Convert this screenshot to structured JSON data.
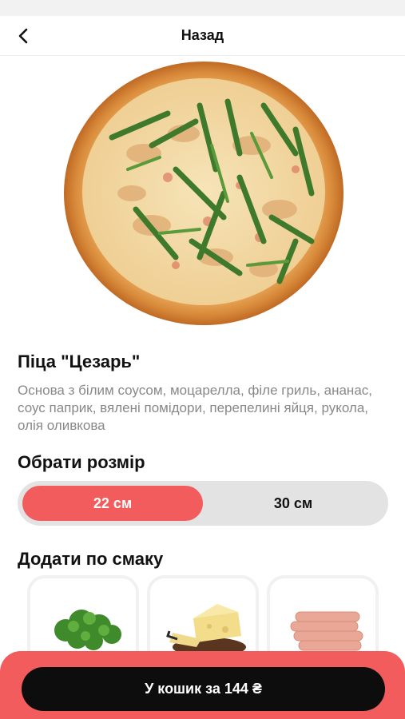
{
  "nav": {
    "back_icon": "chevron-left-icon",
    "title": "Назад"
  },
  "product": {
    "name": "Піца \"Цезарь\"",
    "description": "Основа з білим соусом, моцарелла, філе гриль, ананас, соус паприк, вялені помідори, перепелині яйця, рукола, олія оливкова"
  },
  "size": {
    "heading": "Обрати розмір",
    "options": [
      {
        "label": "22 см",
        "selected": true
      },
      {
        "label": "30 см",
        "selected": false
      }
    ]
  },
  "addons": {
    "heading": "Додати по смаку",
    "items": [
      {
        "icon": "herbs-image"
      },
      {
        "icon": "cheese-image"
      },
      {
        "icon": "sausages-image"
      }
    ]
  },
  "cart": {
    "label": "У кошик за 144 ₴"
  },
  "colors": {
    "accent": "#f25c5c",
    "button_dark": "#0d0d0d",
    "muted_text": "#888888",
    "toggle_bg": "#e3e3e3"
  }
}
